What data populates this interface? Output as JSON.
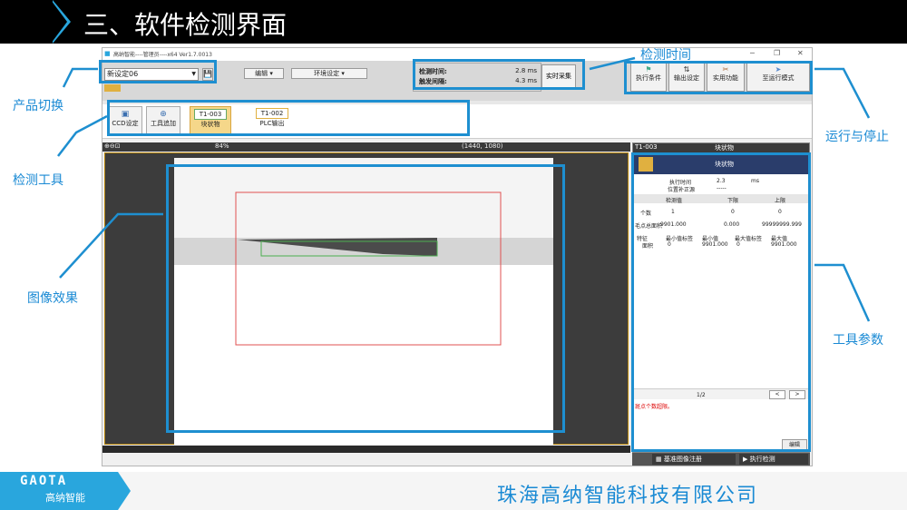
{
  "slide": {
    "title": "三、软件检测界面",
    "footer_logo": "GAOTA",
    "footer_logo_sub": "高纳智能",
    "footer_company": "珠海高纳智能科技有限公司",
    "accent_color": "#1e8fd0"
  },
  "app": {
    "window_title": "高纳智能----管理员----x64 Ver1.7.0013",
    "window_controls": [
      "─",
      "❐",
      "✕"
    ],
    "product_select": "新设定06",
    "menus": [
      "编辑",
      "环境设定"
    ],
    "timing": {
      "detect_label": "检测时间:",
      "detect_value": "2.8 ms",
      "trigger_label": "触发间隔:",
      "trigger_value": "4.3 ms"
    },
    "realtime_button": "实时采集",
    "run_buttons": [
      "执行条件",
      "输出设定",
      "实用功能",
      "至运行模式"
    ],
    "tool_buttons": [
      "CCD设定",
      "工具追加"
    ],
    "tool_items": [
      {
        "code": "T1-003",
        "label": "块状物"
      },
      {
        "code": "T1-002",
        "label": "PLC输出"
      }
    ],
    "viewer": {
      "zoom": "84%",
      "resolution": "(1440, 1080)"
    },
    "panel": {
      "header_code": "T1-003",
      "header_name": "块状物",
      "title": "块状物",
      "exec_time_label": "执行时间",
      "exec_time_value": "2.3",
      "exec_time_unit": "ms",
      "pos_comp_label": "位置补正源",
      "pos_comp_value": "-----",
      "col_headers": [
        "检测值",
        "下限",
        "上限"
      ],
      "rows": [
        {
          "name": "个数",
          "value": "1",
          "low": "0",
          "high": "0"
        },
        {
          "name": "毛点总面积",
          "value": "9901.000",
          "low": "0.000",
          "high": "99999999.999"
        }
      ],
      "feat_headers": [
        "特征",
        "最小值标签",
        "最小值",
        "最大值标签",
        "最大值"
      ],
      "feat_row": [
        "面积",
        "0",
        "9901.000",
        "0",
        "9901.000"
      ],
      "page": "1/2",
      "prev": "<",
      "next": ">",
      "note": "斑点个数超限。",
      "edit_button": "编辑"
    },
    "bottom_tabs": [
      "基准图像注册",
      "执行检测"
    ]
  },
  "annotations": {
    "product_switch": "产品切换",
    "detect_tools": "检测工具",
    "image_effect": "图像效果",
    "detect_time": "检测时间",
    "run_stop": "运行与停止",
    "tool_params": "工具参数"
  }
}
